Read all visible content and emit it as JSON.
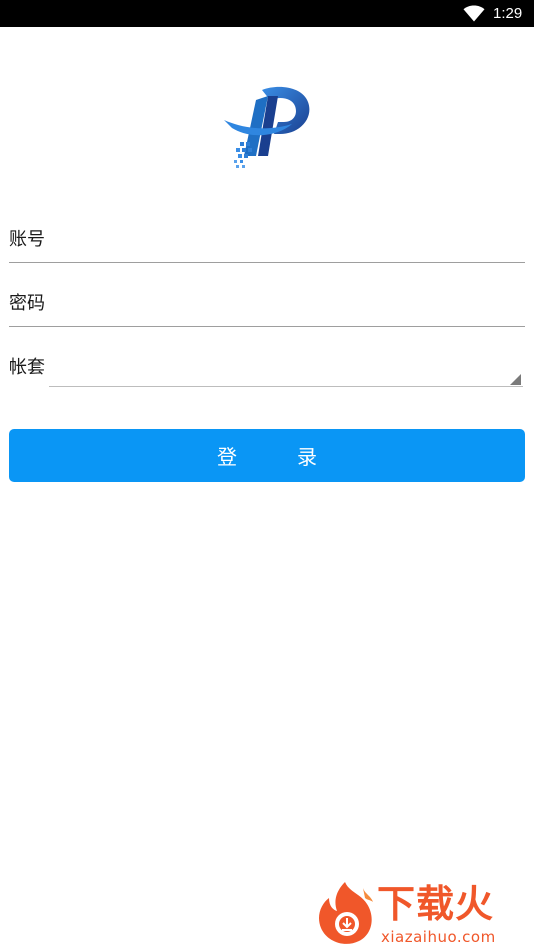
{
  "status_bar": {
    "time": "1:29",
    "wifi_icon": "wifi-icon"
  },
  "logo": {
    "icon": "company-logo-icon",
    "primary_color": "#1f6fc4",
    "dark_color": "#1a3f8f"
  },
  "form": {
    "account": {
      "label": "账号",
      "value": "",
      "placeholder": ""
    },
    "password": {
      "label": "密码",
      "value": "",
      "placeholder": ""
    },
    "book": {
      "label": "帐套",
      "selected": ""
    }
  },
  "login_button": {
    "label": "登录",
    "color": "#0a96f5"
  },
  "watermark": {
    "title": "下载火",
    "url": "xiazaihuo.com",
    "color": "#f0572a"
  }
}
